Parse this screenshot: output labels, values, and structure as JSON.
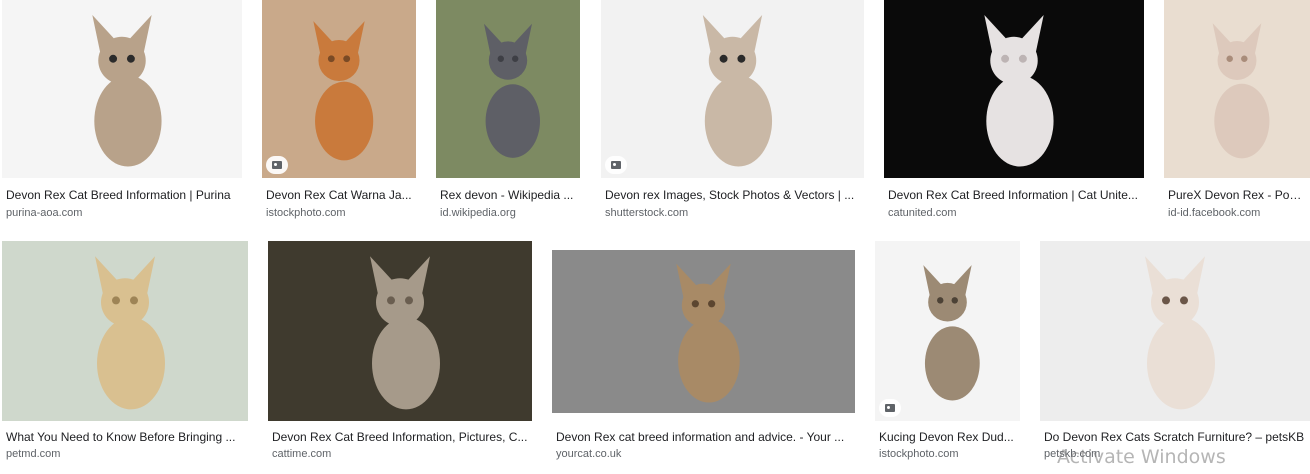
{
  "results": [
    {
      "caption": "Devon Rex Cat Breed Information | Purina",
      "source": "purina-aoa.com",
      "bg": "#f5f5f5",
      "cat": "#b8a28a",
      "accent": "#2b2b2b"
    },
    {
      "caption": "Devon Rex Cat Warna Ja...",
      "source": "istockphoto.com",
      "bg": "#c9a98a",
      "cat": "#c97a3c",
      "accent": "#7a4a25",
      "icon": "image-icon"
    },
    {
      "caption": "Rex devon - Wikipedia ...",
      "source": "id.wikipedia.org",
      "bg": "#7d8a62",
      "cat": "#5e5f66",
      "accent": "#3e3f45"
    },
    {
      "caption": "Devon rex Images, Stock Photos & Vectors | ...",
      "source": "shutterstock.com",
      "bg": "#f2f2f2",
      "cat": "#c9b8a6",
      "accent": "#2a2a2a",
      "icon": "image-icon"
    },
    {
      "caption": "Devon Rex Cat Breed Information | Cat Unite...",
      "source": "catunited.com",
      "bg": "#0a0a0a",
      "cat": "#e6e2e2",
      "accent": "#bdb4b4"
    },
    {
      "caption": "PureX Devon Rex - Post...",
      "source": "id-id.facebook.com",
      "bg": "#e9ddd0",
      "cat": "#ddc9bc",
      "accent": "#a98c7a"
    },
    {
      "caption": "What You Need to Know Before Bringing ...",
      "source": "petmd.com",
      "bg": "#cfd8cc",
      "cat": "#d9c090",
      "accent": "#9e8456"
    },
    {
      "caption": "Devon Rex Cat Breed Information, Pictures, C...",
      "source": "cattime.com",
      "bg": "#3f3a2e",
      "cat": "#a69a8a",
      "accent": "#6a5e50"
    },
    {
      "caption": "Devon Rex cat breed information and advice. - Your ...",
      "source": "yourcat.co.uk",
      "bg": "#8a8a8a",
      "cat": "#a88a66",
      "accent": "#5c4630"
    },
    {
      "caption": "Kucing Devon Rex Dud...",
      "source": "istockphoto.com",
      "bg": "#f4f4f4",
      "cat": "#9c8a74",
      "accent": "#4c4236",
      "icon": "image-icon"
    },
    {
      "caption": "Do Devon Rex Cats Scratch Furniture? – petsKB",
      "source": "petskb.com",
      "bg": "#ededed",
      "cat": "#eadfd6",
      "accent": "#6b5648"
    }
  ],
  "overlay": {
    "watermark": "Activate Windows"
  }
}
